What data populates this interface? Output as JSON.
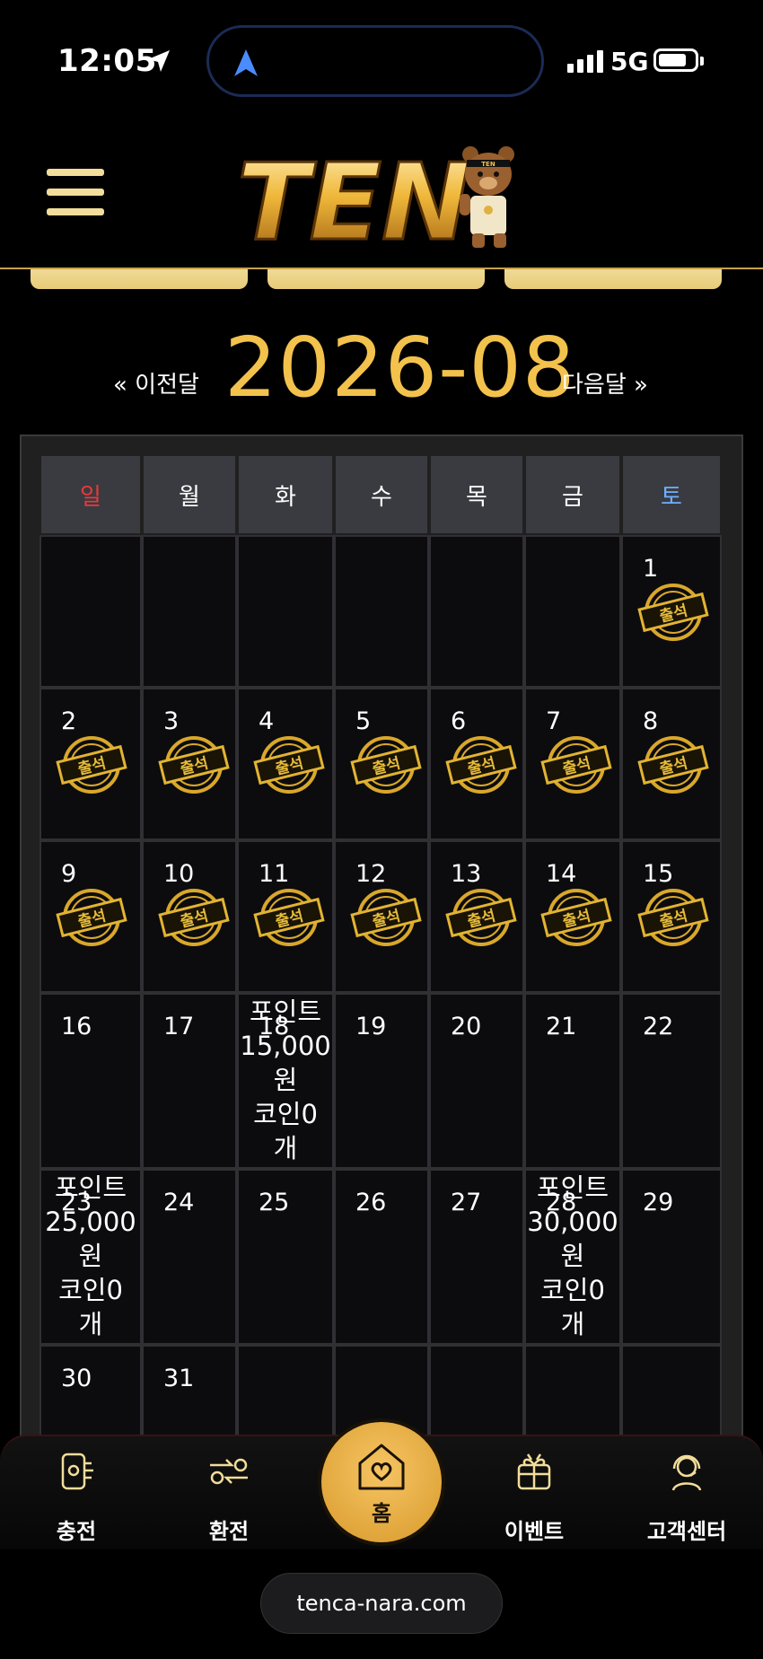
{
  "status": {
    "time": "12:05",
    "network": "5G"
  },
  "header": {
    "logo_text": "TEN",
    "mascot_badge": "TEN"
  },
  "calendar": {
    "prev_label": "« 이전달",
    "title": "2026-08",
    "next_label": "다음달 »",
    "weekdays": [
      "일",
      "월",
      "화",
      "수",
      "목",
      "금",
      "토"
    ],
    "stamp_text": "출석",
    "weeks": [
      [
        null,
        null,
        null,
        null,
        null,
        null,
        {
          "day": "1",
          "stamp": true
        }
      ],
      [
        {
          "day": "2",
          "stamp": true
        },
        {
          "day": "3",
          "stamp": true
        },
        {
          "day": "4",
          "stamp": true
        },
        {
          "day": "5",
          "stamp": true
        },
        {
          "day": "6",
          "stamp": true
        },
        {
          "day": "7",
          "stamp": true
        },
        {
          "day": "8",
          "stamp": true
        }
      ],
      [
        {
          "day": "9",
          "stamp": true
        },
        {
          "day": "10",
          "stamp": true
        },
        {
          "day": "11",
          "stamp": true
        },
        {
          "day": "12",
          "stamp": true
        },
        {
          "day": "13",
          "stamp": true
        },
        {
          "day": "14",
          "stamp": true
        },
        {
          "day": "15",
          "stamp": true
        }
      ],
      [
        {
          "day": "16"
        },
        {
          "day": "17"
        },
        {
          "day": "18",
          "note": [
            "포인트",
            "15,000",
            "원",
            "코인0",
            "개"
          ]
        },
        {
          "day": "19"
        },
        {
          "day": "20"
        },
        {
          "day": "21"
        },
        {
          "day": "22"
        }
      ],
      [
        {
          "day": "23",
          "note": [
            "포인트",
            "25,000",
            "원",
            "코인0",
            "개"
          ]
        },
        {
          "day": "24"
        },
        {
          "day": "25"
        },
        {
          "day": "26"
        },
        {
          "day": "27"
        },
        {
          "day": "28",
          "note": [
            "포인트",
            "30,000",
            "원",
            "코인0",
            "개"
          ]
        },
        {
          "day": "29"
        }
      ],
      [
        {
          "day": "30"
        },
        {
          "day": "31"
        },
        null,
        null,
        null,
        null,
        null
      ]
    ]
  },
  "bottom_nav": {
    "items": [
      {
        "label": "충전",
        "icon": "charge-icon"
      },
      {
        "label": "환전",
        "icon": "exchange-icon"
      },
      {
        "label": "이벤트",
        "icon": "gift-icon"
      },
      {
        "label": "고객센터",
        "icon": "support-icon"
      }
    ],
    "home_label": "홈"
  },
  "browser": {
    "url": "tenca-nara.com"
  },
  "colors": {
    "accent_gold": "#f3c24c",
    "sunday": "#e83a3a",
    "saturday": "#6fb0ff"
  }
}
